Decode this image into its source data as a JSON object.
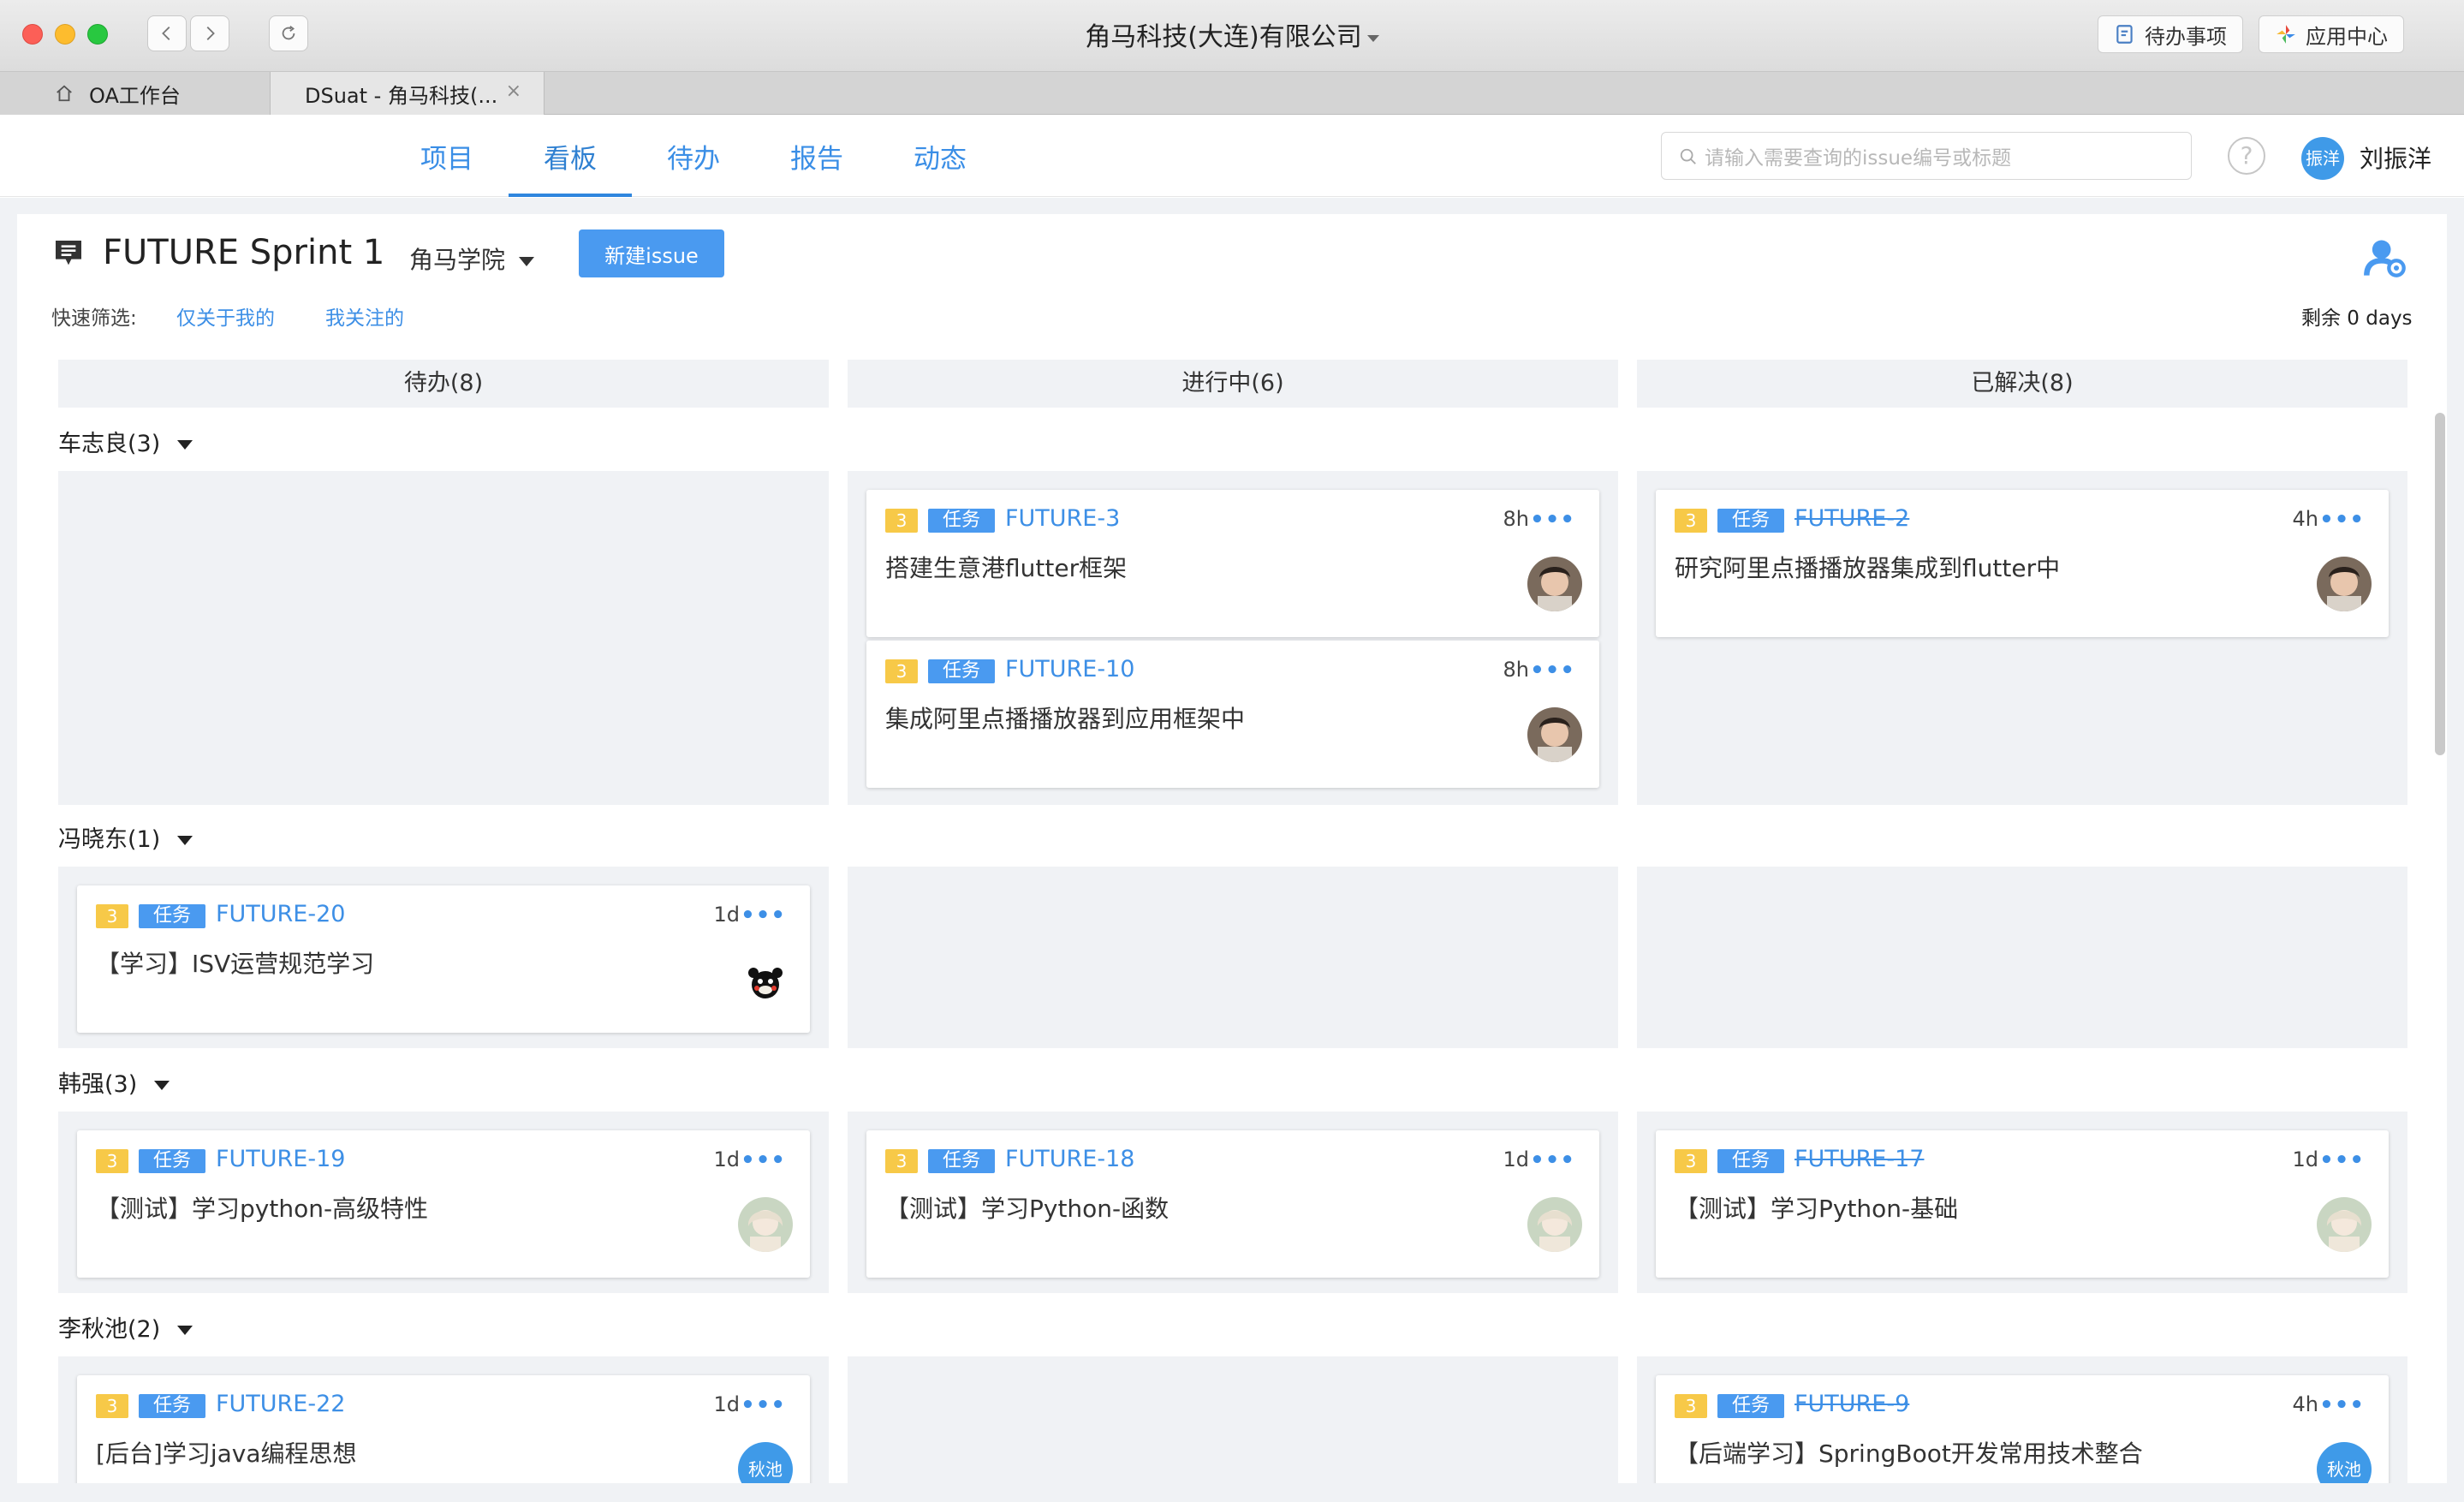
{
  "window": {
    "title": "角马科技(大连)有限公司",
    "todo_button": "待办事项",
    "app_center_button": "应用中心"
  },
  "browser_tabs": [
    {
      "label": "OA工作台"
    },
    {
      "label": "DSuat - 角马科技(...",
      "close": "×"
    }
  ],
  "nav": {
    "tabs": [
      "项目",
      "看板",
      "待办",
      "报告",
      "动态"
    ],
    "active": "看板",
    "search_placeholder": "请输入需要查询的issue编号或标题",
    "help": "?",
    "avatar_text": "振洋",
    "user_name": "刘振洋"
  },
  "sprint": {
    "title": "FUTURE Sprint 1",
    "project": "角马学院",
    "new_issue_button": "新建issue",
    "quick_filter_label": "快速筛选:",
    "filters": [
      "仅关于我的",
      "我关注的"
    ],
    "remaining": "剩余 0 days"
  },
  "columns": [
    "待办(8)",
    "进行中(6)",
    "已解决(8)"
  ],
  "swimlanes": [
    {
      "name": "车志良(3)",
      "cards": {
        "todo": [],
        "doing": [
          {
            "points": "3",
            "type": "任务",
            "key": "FUTURE-3",
            "estimate": "8h",
            "title": "搭建生意港flutter框架",
            "avatar": "photo-a"
          },
          {
            "points": "3",
            "type": "任务",
            "key": "FUTURE-10",
            "estimate": "8h",
            "title": "集成阿里点播播放器到应用框架中",
            "avatar": "photo-a"
          }
        ],
        "done": [
          {
            "points": "3",
            "type": "任务",
            "key": "FUTURE-2",
            "estimate": "4h",
            "title": "研究阿里点播播放器集成到flutter中",
            "avatar": "photo-a"
          }
        ]
      }
    },
    {
      "name": "冯晓东(1)",
      "cards": {
        "todo": [
          {
            "points": "3",
            "type": "任务",
            "key": "FUTURE-20",
            "estimate": "1d",
            "title": "【学习】ISV运营规范学习",
            "avatar": "bear"
          }
        ],
        "doing": [],
        "done": []
      }
    },
    {
      "name": "韩强(3)",
      "cards": {
        "todo": [
          {
            "points": "3",
            "type": "任务",
            "key": "FUTURE-19",
            "estimate": "1d",
            "title": "【测试】学习python-高级特性",
            "avatar": "photo-b"
          }
        ],
        "doing": [
          {
            "points": "3",
            "type": "任务",
            "key": "FUTURE-18",
            "estimate": "1d",
            "title": "【测试】学习Python-函数",
            "avatar": "photo-b"
          }
        ],
        "done": [
          {
            "points": "3",
            "type": "任务",
            "key": "FUTURE-17",
            "estimate": "1d",
            "title": "【测试】学习Python-基础",
            "avatar": "photo-b"
          }
        ]
      }
    },
    {
      "name": "李秋池(2)",
      "cards": {
        "todo": [
          {
            "points": "3",
            "type": "任务",
            "key": "FUTURE-22",
            "estimate": "1d",
            "title": "[后台]学习java编程思想",
            "avatar": "秋池"
          }
        ],
        "doing": [],
        "done": [
          {
            "points": "3",
            "type": "任务",
            "key": "FUTURE-9",
            "estimate": "4h",
            "title": "【后端学习】SpringBoot开发常用技术整合",
            "avatar": "秋池"
          }
        ]
      }
    }
  ],
  "colors": {
    "accent": "#3d8fe6",
    "button": "#4a9af0",
    "points_badge": "#f7c948",
    "column_bg": "#f0f2f5"
  }
}
